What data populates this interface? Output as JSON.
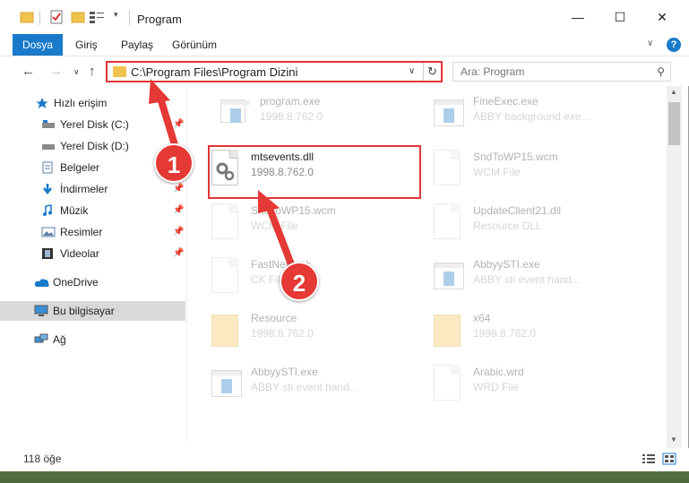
{
  "window": {
    "title": "Program",
    "controls": {
      "minimize": "—",
      "maximize": "☐",
      "close": "✕"
    }
  },
  "ribbon": {
    "tabs": [
      "Dosya",
      "Giriş",
      "Paylaş",
      "Görünüm"
    ]
  },
  "address": {
    "path": "C:\\Program Files\\Program Dizini"
  },
  "search": {
    "placeholder": "Ara: Program"
  },
  "sidebar": {
    "items": [
      {
        "label": "Hızlı erişim",
        "icon": "star-icon",
        "pinned": false
      },
      {
        "label": "Yerel Disk (C:)",
        "icon": "drive-icon",
        "pinned": true
      },
      {
        "label": "Yerel Disk (D:)",
        "icon": "drive-icon",
        "pinned": false
      },
      {
        "label": "Belgeler",
        "icon": "documents-icon",
        "pinned": true
      },
      {
        "label": "İndirmeler",
        "icon": "download-icon",
        "pinned": true
      },
      {
        "label": "Müzik",
        "icon": "music-icon",
        "pinned": true
      },
      {
        "label": "Resimler",
        "icon": "pictures-icon",
        "pinned": true
      },
      {
        "label": "Videolar",
        "icon": "videos-icon",
        "pinned": true
      },
      {
        "label": "OneDrive",
        "icon": "cloud-icon",
        "pinned": false
      },
      {
        "label": "Bu bilgisayar",
        "icon": "computer-icon",
        "pinned": false,
        "selected": true
      },
      {
        "label": "Ağ",
        "icon": "network-icon",
        "pinned": false
      }
    ]
  },
  "files": [
    {
      "name": "program.exe",
      "meta": "1998.8.762.0",
      "kind": "exe"
    },
    {
      "name": "FineExec.exe",
      "meta": "ABBY background exe...",
      "kind": "app"
    },
    {
      "name": "mtsevents.dll",
      "meta": "1998.8.762.0",
      "kind": "dll"
    },
    {
      "name": "SndToWP15.wcm",
      "meta": "WCM File",
      "kind": "doc"
    },
    {
      "name": "SndToWP15.wcm",
      "meta": "WCM File",
      "kind": "doc"
    },
    {
      "name": "UpdateClient21.dll",
      "meta": "Resource DLL",
      "kind": "dll"
    },
    {
      "name": "FastNet.fask",
      "meta": "CK File",
      "kind": "doc"
    },
    {
      "name": "AbbyySTI.exe",
      "meta": "ABBY sti event hand...",
      "kind": "app"
    },
    {
      "name": "Resource",
      "meta": "1998.8.762.0",
      "kind": "folder"
    },
    {
      "name": "x64",
      "meta": "1998.8.762.0",
      "kind": "folder"
    },
    {
      "name": "AbbyySTI.exe",
      "meta": "ABBY sti event hand...",
      "kind": "app"
    },
    {
      "name": "Arabic.wrd",
      "meta": "WRD File",
      "kind": "doc"
    }
  ],
  "status": {
    "count": "118 öğe"
  },
  "annotations": {
    "callout1": "1",
    "callout2": "2"
  },
  "colors": {
    "accent": "#1979ca",
    "highlight": "#e03437",
    "callout": "#e53935"
  }
}
